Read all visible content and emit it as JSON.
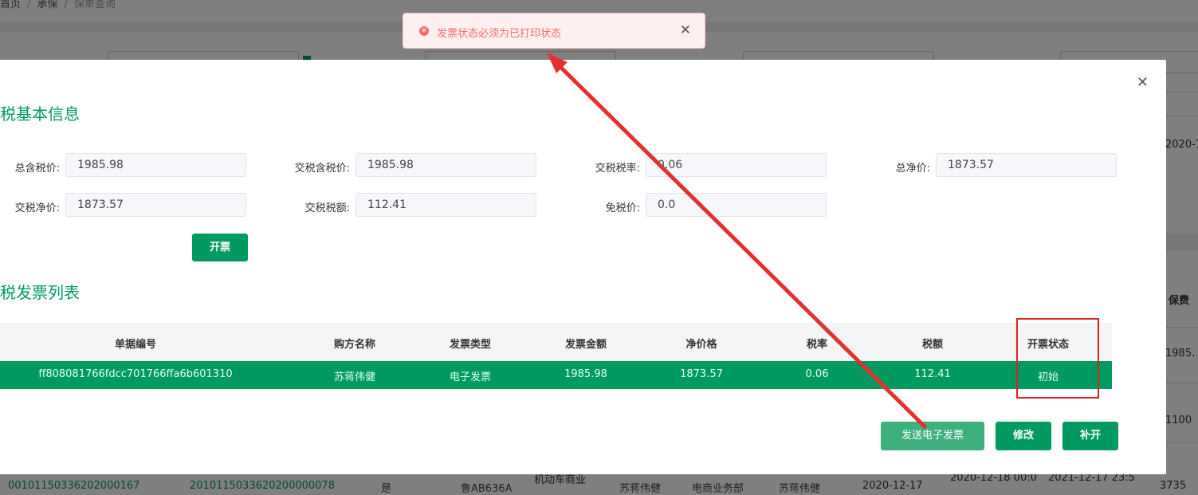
{
  "breadcrumb": {
    "home": "首页",
    "mid": "承保",
    "current": "保单查询"
  },
  "background_table": {
    "row_values": [
      "00101150336202000167",
      "2010115033620200000078",
      "是",
      "鲁AB636A",
      "机动车商业",
      "苏蒋伟健",
      "电商业务部",
      "苏蒋伟健",
      "2020-12-17",
      "2020-12-18 00:0",
      "2021-12-17 23:5",
      "3735"
    ],
    "right_col_header": "保费",
    "right_col_values": [
      "1985.",
      "1100"
    ],
    "right_date": "2020-1"
  },
  "toast": {
    "message": "发票状态必须为已打印状态",
    "icon": "error-icon",
    "color": "#f56c6c"
  },
  "modal": {
    "basic_title": "税基本信息",
    "list_title": "税发票列表",
    "fields": [
      {
        "label": "总含税价:",
        "value": "1985.98"
      },
      {
        "label": "交税含税价:",
        "value": "1985.98"
      },
      {
        "label": "交税税率:",
        "value": "0.06"
      },
      {
        "label": "总净价:",
        "value": "1873.57"
      },
      {
        "label": "交税净价:",
        "value": "1873.57"
      },
      {
        "label": "交税税额:",
        "value": "112.41"
      },
      {
        "label": "免税价:",
        "value": "0.0"
      }
    ],
    "issue_button": "开票",
    "table": {
      "headers": [
        "单据编号",
        "购方名称",
        "发票类型",
        "发票金额",
        "净价格",
        "税率",
        "税额",
        "开票状态"
      ],
      "rows": [
        [
          "ff808081766fdcc701766ffa6b601310",
          "苏蒋伟健",
          "电子发票",
          "1985.98",
          "1873.57",
          "0.06",
          "112.41",
          "初始"
        ]
      ]
    },
    "actions": {
      "send": "发送电子发票",
      "edit": "修改",
      "reissue": "补开"
    }
  },
  "colors": {
    "primary": "#009a61",
    "annotation": "#e02020"
  }
}
